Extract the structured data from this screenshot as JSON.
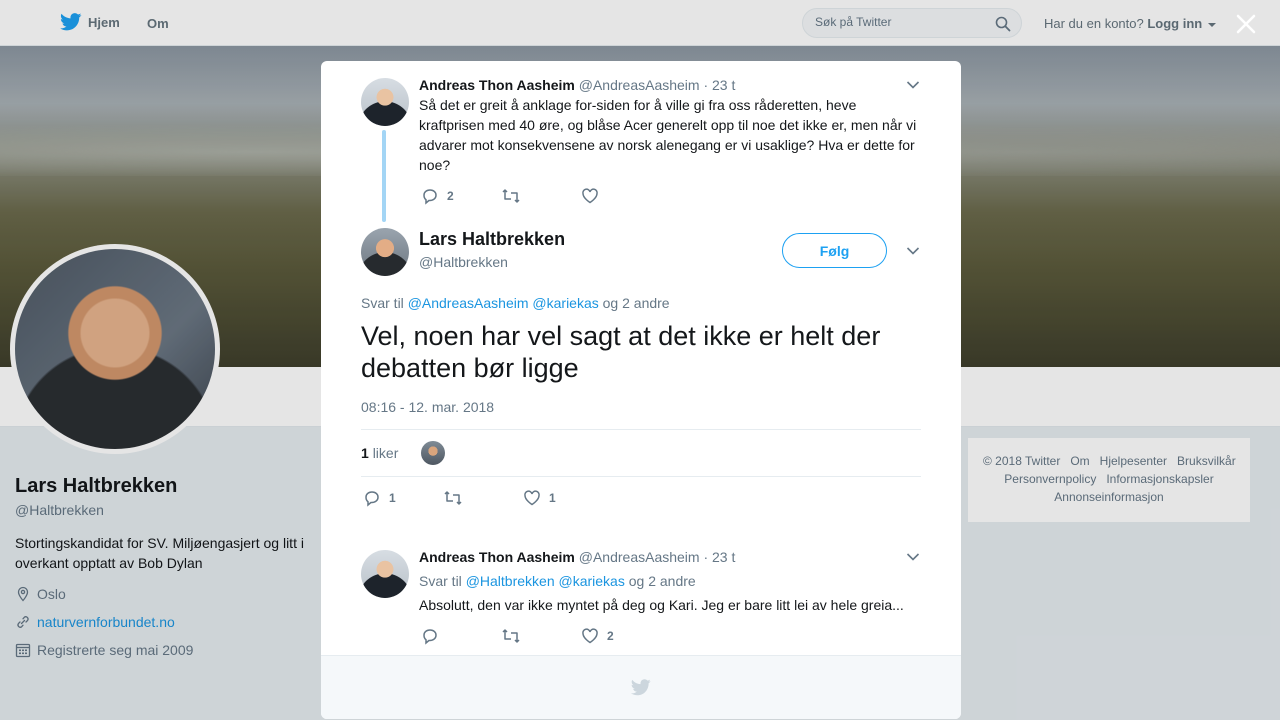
{
  "nav": {
    "home_label": "Hjem",
    "about_label": "Om",
    "search_placeholder": "Søk på Twitter",
    "account_prompt": "Har du en konto?",
    "login_label": "Logg inn"
  },
  "profile": {
    "name": "Lars Haltbrekken",
    "handle": "@Haltbrekken",
    "bio": "Stortingskandidat for SV. Miljøengasjert og litt i overkant opptatt av Bob Dylan",
    "location": "Oslo",
    "website": "naturvernforbundet.no",
    "joined": "Registrerte seg mai 2009"
  },
  "footer": {
    "links": [
      "© 2018 Twitter",
      "Om",
      "Hjelpesenter",
      "Bruksvilkår",
      "Personvernpolicy",
      "Informasjonskapsler",
      "Annonseinformasjon"
    ]
  },
  "modal": {
    "parent_tweet": {
      "name": "Andreas Thon Aasheim",
      "handle": "@AndreasAasheim",
      "time": "· 23 t",
      "text": "Så det er greit å anklage for-siden for å ville gi fra oss råderetten, heve kraftprisen med 40 øre, og blåse Acer generelt opp til noe det ikke er, men når vi advarer mot konsekvensene av norsk alenegang er vi usaklige? Hva er dette for noe?",
      "replies": "2",
      "retweets": "",
      "likes": ""
    },
    "main_tweet": {
      "name": "Lars Haltbrekken",
      "handle": "@Haltbrekken",
      "follow_label": "Følg",
      "reply_prefix": "Svar til",
      "mention1": "@AndreasAasheim",
      "mention2": "@kariekas",
      "reply_suffix": "og 2 andre",
      "text": "Vel, noen har vel sagt at det ikke er helt der debatten bør ligge",
      "timestamp": "08:16 - 12. mar. 2018",
      "likes_count": "1",
      "likes_label": "liker",
      "replies": "1",
      "retweets": "",
      "likes": "1"
    },
    "reply_tweet": {
      "name": "Andreas Thon Aasheim",
      "handle": "@AndreasAasheim",
      "time": "· 23 t",
      "reply_prefix": "Svar til",
      "mention1": "@Haltbrekken",
      "mention2": "@kariekas",
      "reply_suffix": "og 2 andre",
      "text": "Absolutt, den var ikke myntet på deg og Kari. Jeg er bare litt lei av hele greia...",
      "replies": "",
      "retweets": "",
      "likes": "2"
    }
  },
  "colors": {
    "accent": "#1da1f2",
    "link": "#1b95e0",
    "muted": "#657786",
    "thread_line": "#a3d5f5"
  }
}
